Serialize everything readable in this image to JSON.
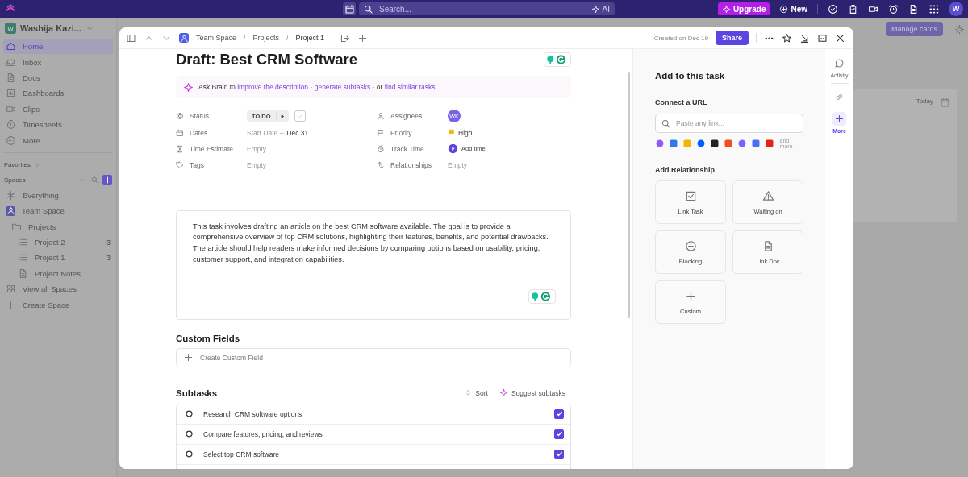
{
  "topbar": {
    "search_placeholder": "Search...",
    "ai": "AI",
    "upgrade": "Upgrade",
    "new": "New",
    "avatar": "W"
  },
  "sidebar": {
    "workspace": {
      "initial": "W",
      "name": "Washija Kazi..."
    },
    "nav": [
      {
        "label": "Home",
        "selected": true
      },
      {
        "label": "Inbox",
        "selected": false
      },
      {
        "label": "Docs",
        "selected": false
      },
      {
        "label": "Dashboards",
        "selected": false
      },
      {
        "label": "Clips",
        "selected": false
      },
      {
        "label": "Timesheets",
        "selected": false
      },
      {
        "label": "More",
        "selected": false
      }
    ],
    "favorites": "Favorites",
    "spaces": "Spaces",
    "tree": [
      {
        "label": "Everything",
        "kind": "everything"
      },
      {
        "label": "Team Space",
        "kind": "space",
        "children": [
          {
            "label": "Projects",
            "kind": "folder",
            "children": [
              {
                "label": "Project 2",
                "kind": "list",
                "count": "3"
              },
              {
                "label": "Project 1",
                "kind": "list",
                "count": "3"
              },
              {
                "label": "Project Notes",
                "kind": "doc"
              }
            ]
          }
        ]
      }
    ],
    "actions": [
      "View all Spaces",
      "Create Space"
    ]
  },
  "background": {
    "manage_cards": "Manage cards",
    "today": "Today"
  },
  "task": {
    "breadcrumb": [
      "Team Space",
      "Projects",
      "Project 1"
    ],
    "separator": "/",
    "created": "Created on Dec 19",
    "share": "Share",
    "title": "Draft: Best CRM Software",
    "brain": [
      {
        "kind": "text",
        "text": "Ask Brain to"
      },
      {
        "kind": "link",
        "text": "improve the description"
      },
      {
        "kind": "text",
        "text": "·"
      },
      {
        "kind": "link",
        "text": "generate subtasks"
      },
      {
        "kind": "text",
        "text": "· or"
      },
      {
        "kind": "link",
        "text": "find similar tasks"
      }
    ],
    "fields": [
      {
        "label": "Status",
        "kind": "status",
        "value": "TO DO",
        "done": false
      },
      {
        "label": "Assignees",
        "kind": "avatar",
        "value": "WK"
      },
      {
        "label": "Dates",
        "kind": "dates",
        "value": "Start Date –",
        "due": "Dec 31"
      },
      {
        "label": "Priority",
        "kind": "priority",
        "value": "High"
      },
      {
        "label": "Time Estimate",
        "kind": "empty",
        "value": "Empty"
      },
      {
        "label": "Track Time",
        "kind": "timer",
        "value": "Add time"
      },
      {
        "label": "Tags",
        "kind": "empty",
        "value": "Empty"
      },
      {
        "label": "Relationships",
        "kind": "empty",
        "value": "Empty"
      }
    ],
    "description": "This task involves drafting an article on the best CRM software available. The goal is to provide a comprehensive overview of top CRM solutions, highlighting their features, benefits, and potential drawbacks. The article should help readers make informed decisions by comparing options based on usability, pricing, customer support, and integration capabilities.",
    "custom_fields": {
      "title": "Custom Fields",
      "create": "Create Custom Field"
    },
    "subtasks": {
      "title": "Subtasks",
      "sort": "Sort",
      "suggest": "Suggest subtasks",
      "items": [
        {
          "label": "Research CRM software options",
          "checked": true
        },
        {
          "label": "Compare features, pricing, and reviews",
          "checked": true
        },
        {
          "label": "Select top CRM software",
          "checked": true
        }
      ]
    }
  },
  "panel": {
    "title": "Add to this task",
    "url_title": "Connect a URL",
    "url_placeholder": "Paste any link...",
    "and_more": "and more",
    "relation_title": "Add Relationship",
    "relations": [
      "Link Task",
      "Waiting on",
      "Blocking",
      "Link Doc",
      "Custom"
    ]
  },
  "rail": [
    {
      "label": "Activity",
      "selected": false
    },
    {
      "label": "More",
      "selected": true
    }
  ]
}
